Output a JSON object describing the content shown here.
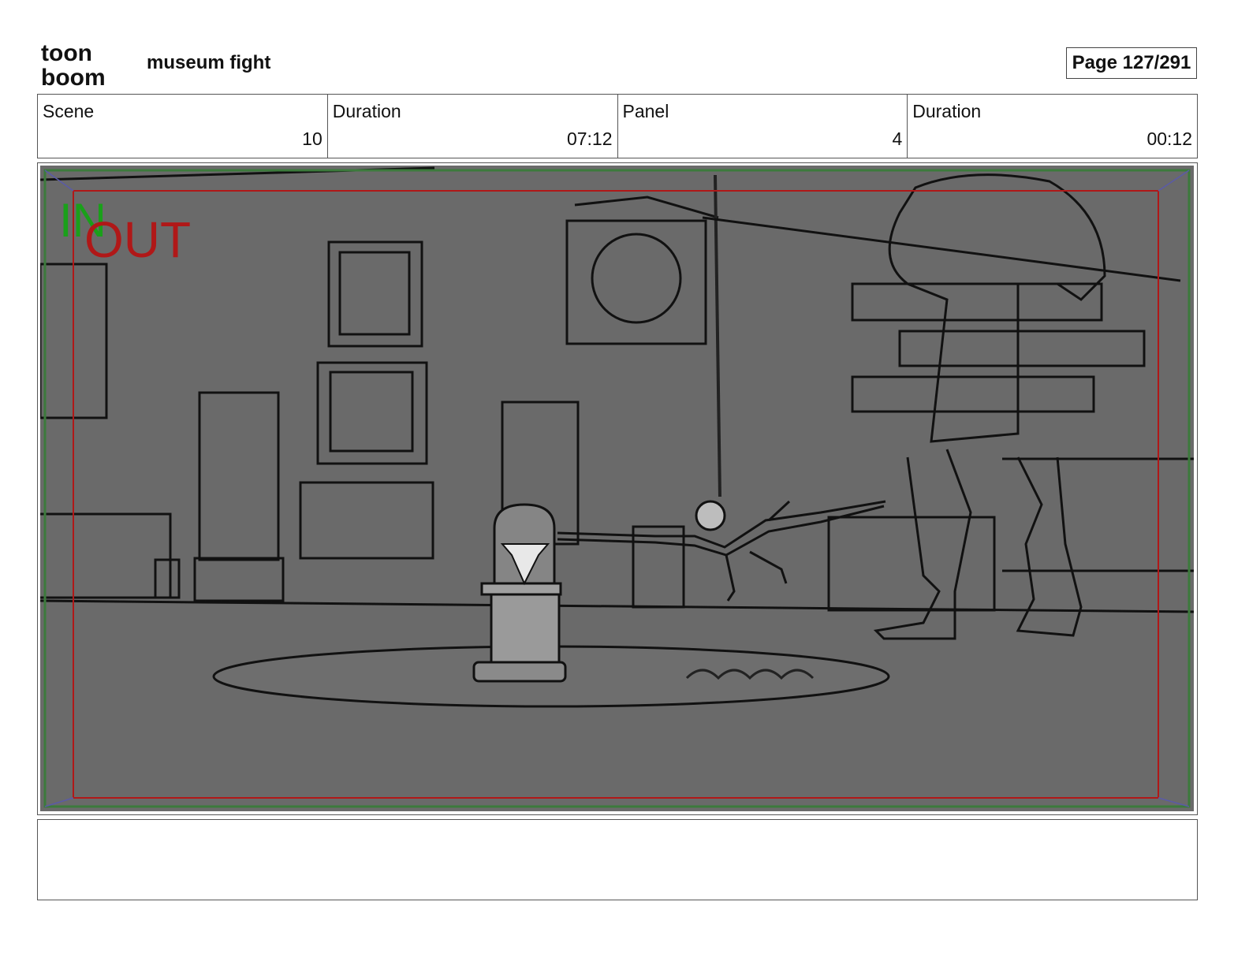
{
  "header": {
    "logo": {
      "line1": "toon",
      "line2": "boom"
    },
    "project_title": "museum fight",
    "page_label": "Page 127/291"
  },
  "info": {
    "scene_label": "Scene",
    "scene_value": "10",
    "scene_duration_label": "Duration",
    "scene_duration_value": "07:12",
    "panel_label": "Panel",
    "panel_value": "4",
    "panel_duration_label": "Duration",
    "panel_duration_value": "00:12"
  },
  "panel": {
    "in_marker": "IN",
    "out_marker": "OUT",
    "colors": {
      "background": "#6a6a6a",
      "safe_frame": "#3c7a3c",
      "action_frame": "#b01818",
      "in_marker": "#1aa01a",
      "out_marker": "#b01818"
    }
  },
  "notes": {
    "text": ""
  }
}
